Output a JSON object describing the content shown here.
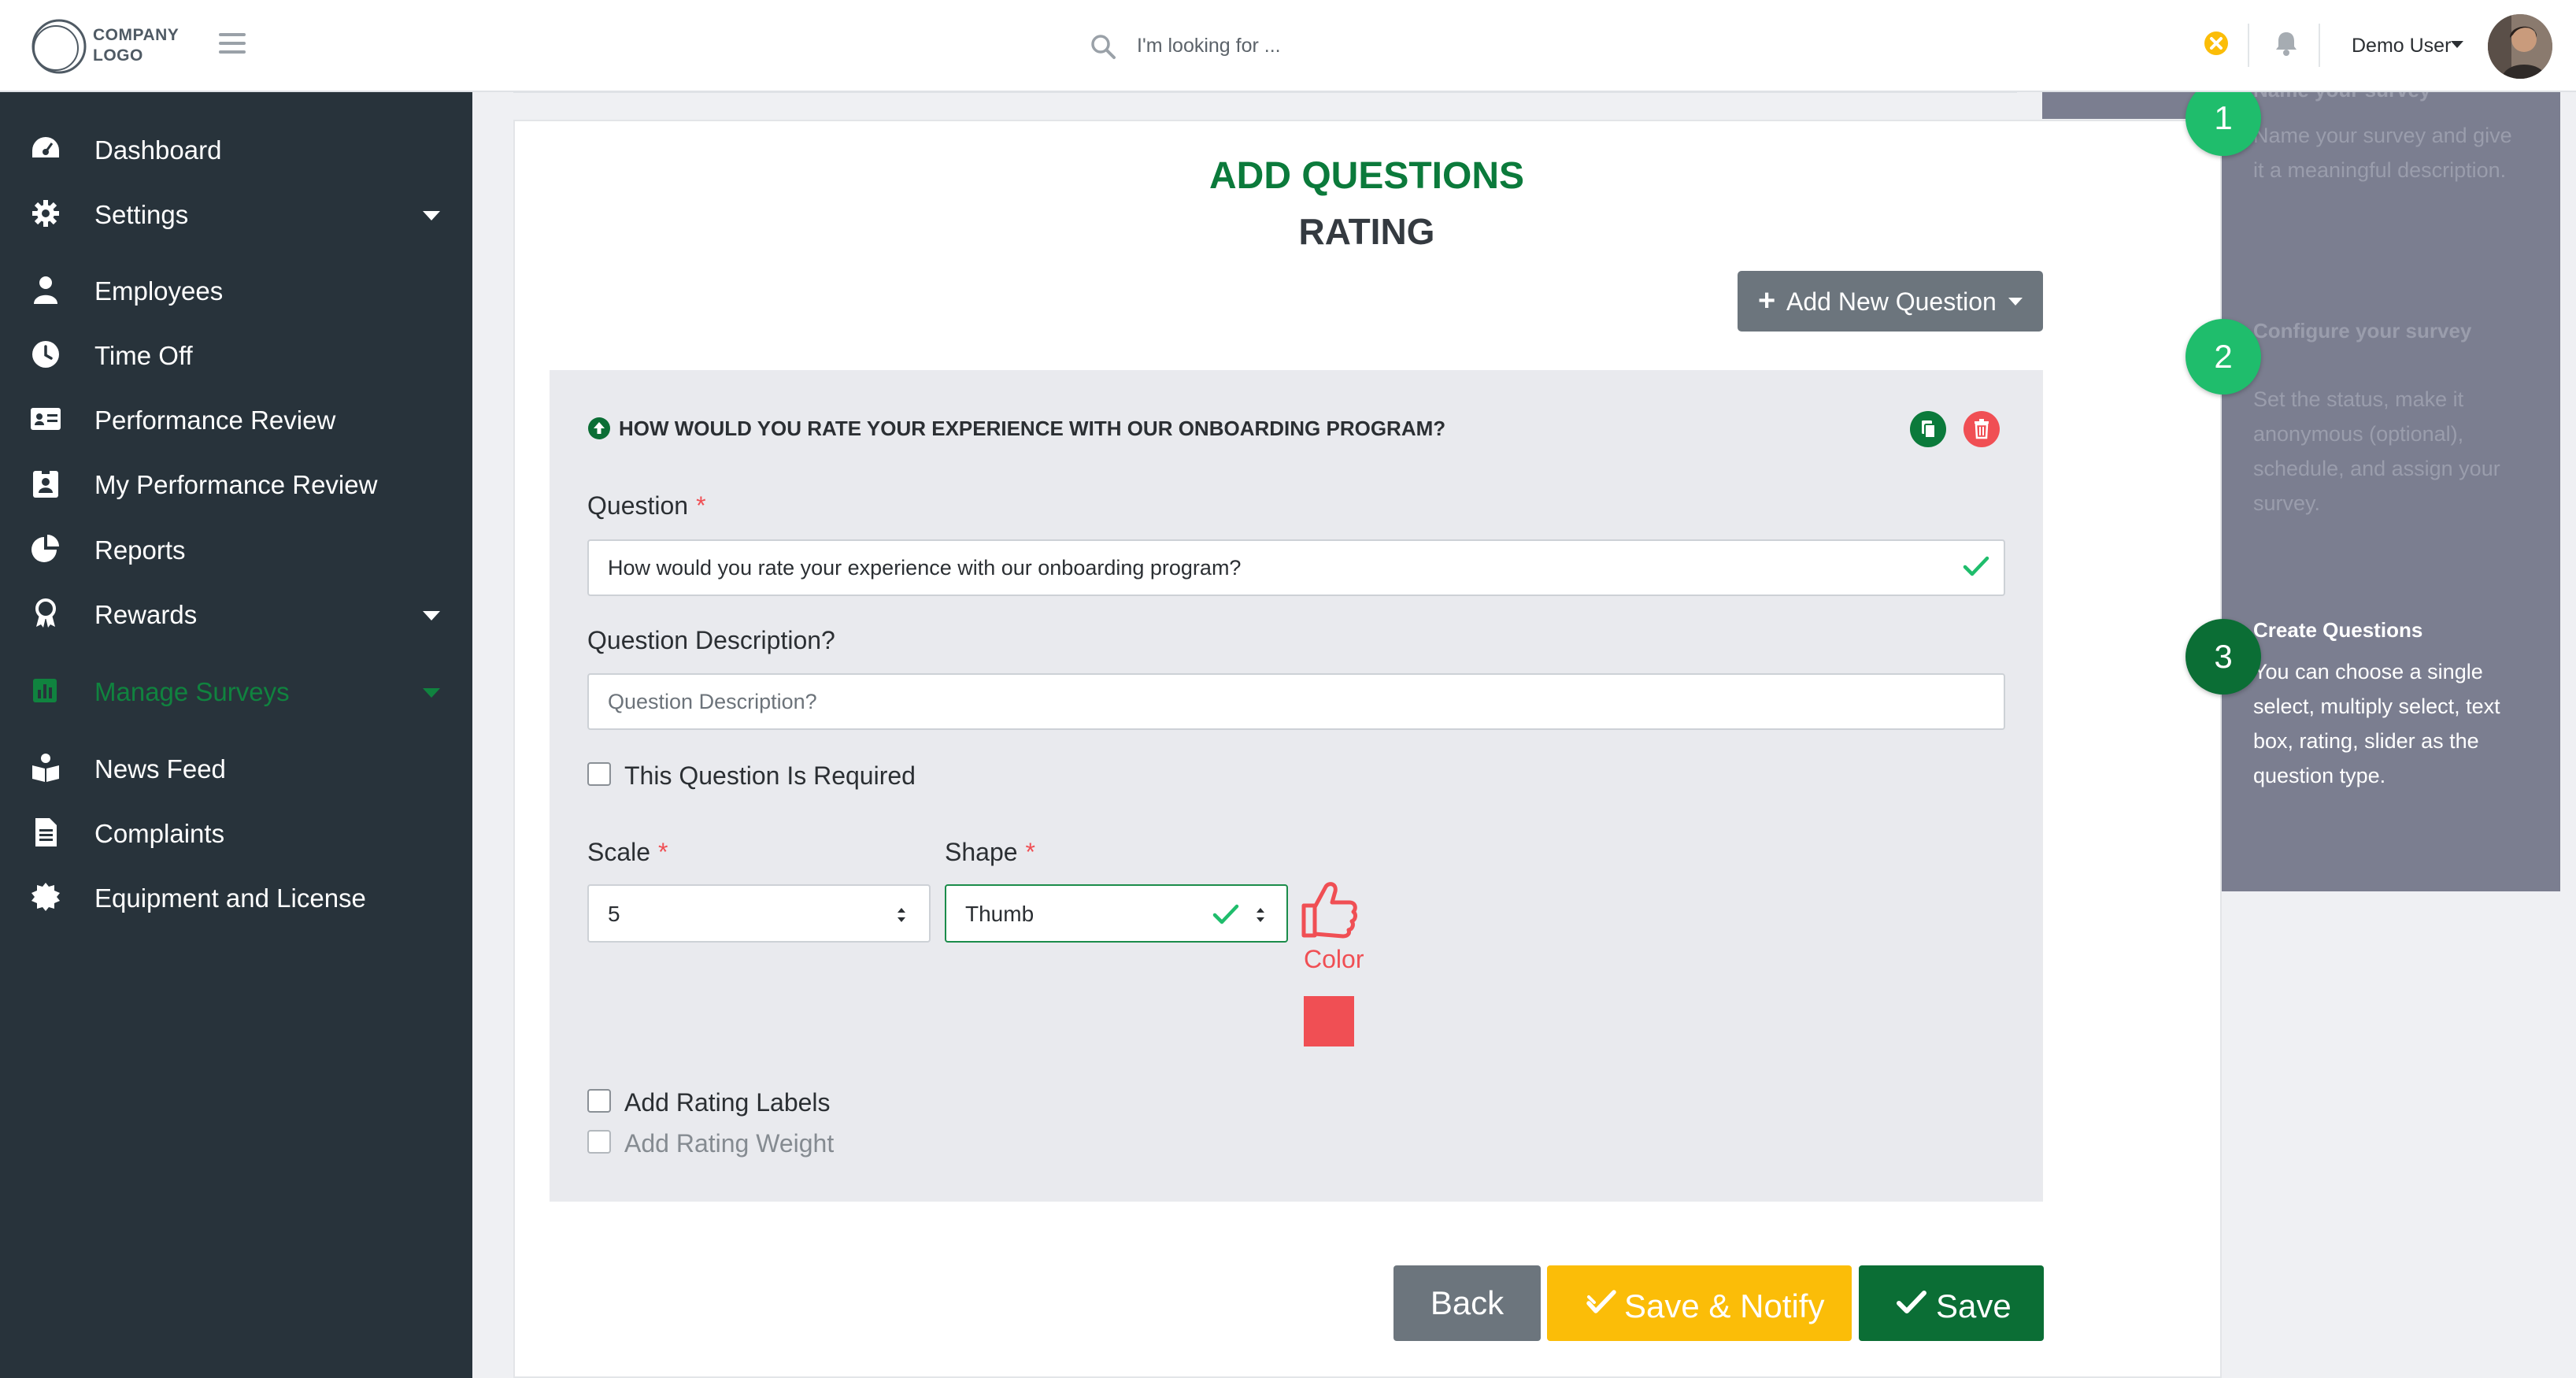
{
  "header": {
    "logo_text": "COMPANY\nLOGO",
    "search_placeholder": "I'm looking for ...",
    "user_name": "Demo User"
  },
  "sidebar": {
    "items": [
      {
        "label": "Dashboard",
        "icon": "dashboard-icon"
      },
      {
        "label": "Settings",
        "icon": "gear-icon",
        "has_submenu": true
      },
      {
        "label": "Employees",
        "icon": "employee-icon"
      },
      {
        "label": "Time Off",
        "icon": "clock-icon"
      },
      {
        "label": "Performance Review",
        "icon": "id-card-icon"
      },
      {
        "label": "My Performance Review",
        "icon": "id-badge-icon"
      },
      {
        "label": "Reports",
        "icon": "pie-chart-icon"
      },
      {
        "label": "Rewards",
        "icon": "award-icon",
        "has_submenu": true
      },
      {
        "label": "Manage Surveys",
        "icon": "poll-icon",
        "has_submenu": true,
        "active": true
      },
      {
        "label": "News Feed",
        "icon": "news-feed-icon"
      },
      {
        "label": "Complaints",
        "icon": "document-icon"
      },
      {
        "label": "Equipment and License",
        "icon": "cog-badge-icon"
      }
    ]
  },
  "main": {
    "title": "ADD QUESTIONS",
    "subtitle": "RATING",
    "add_question_label": "Add New Question",
    "question_card": {
      "heading": "HOW WOULD YOU RATE YOUR EXPERIENCE WITH OUR ONBOARDING PROGRAM?",
      "question_label": "Question",
      "question_value": "How would you rate your experience with our onboarding program?",
      "description_label": "Question Description?",
      "description_placeholder": "Question Description?",
      "required_label": "This Question Is Required",
      "required_checked": false,
      "scale_label": "Scale",
      "scale_value": "5",
      "shape_label": "Shape",
      "shape_value": "Thumb",
      "color_label": "Color",
      "color_value": "#f04f54",
      "rating_labels_label": "Add Rating Labels",
      "rating_weight_label": "Add Rating Weight"
    },
    "buttons": {
      "back": "Back",
      "save_notify": "Save & Notify",
      "save": "Save"
    }
  },
  "steps": [
    {
      "number": "1",
      "title": "Name your survey",
      "description": "Name your survey and give it a meaningful description.",
      "active": false
    },
    {
      "number": "2",
      "title": "Configure your survey",
      "description": "Set the status, make it anonymous (optional), schedule, and assign your survey.",
      "active": false
    },
    {
      "number": "3",
      "title": "Create Questions",
      "description": "You can choose a single select, multiply select, text box, rating, slider as the question type.",
      "active": true
    }
  ],
  "colors": {
    "sidebar_bg": "#28333b",
    "brand_green": "#0b7a3b",
    "accent_red": "#f04f54",
    "warning_yellow": "#fbbd08",
    "steps_bg": "#7b7e90"
  }
}
